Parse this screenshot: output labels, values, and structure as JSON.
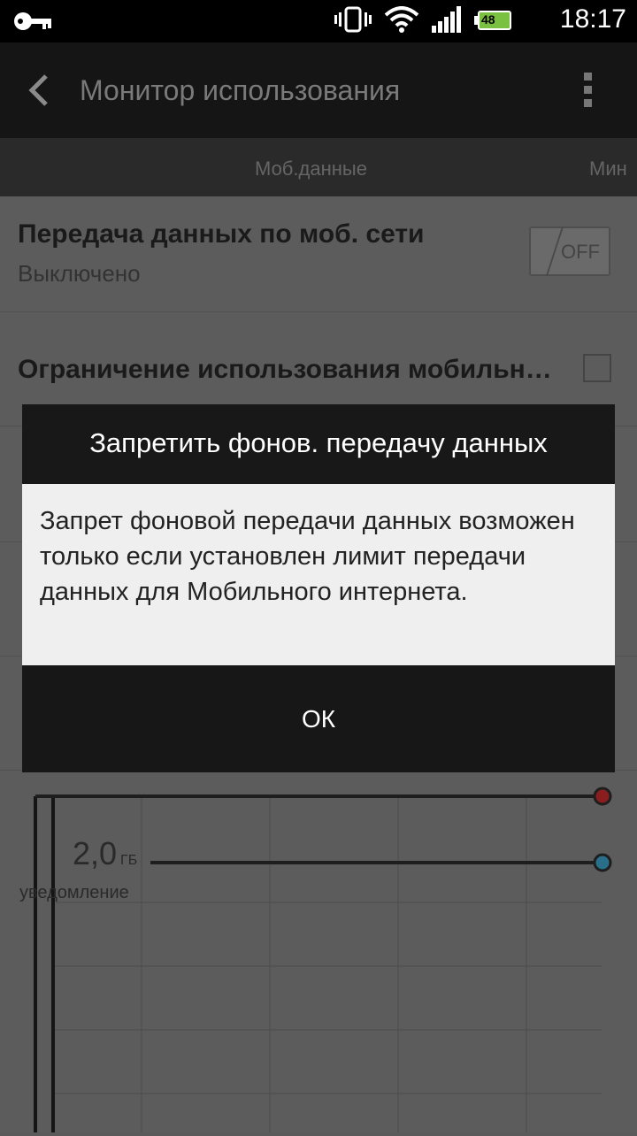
{
  "status_bar": {
    "icons": [
      "key-icon",
      "vibrate-icon",
      "wifi-icon",
      "signal-icon",
      "battery-icon"
    ],
    "battery_level": "48",
    "time": "18:17"
  },
  "action_bar": {
    "title": "Монитор использования"
  },
  "tabs": [
    {
      "label": "Моб.данные"
    },
    {
      "label": "Мин"
    }
  ],
  "settings": {
    "mobile_data": {
      "title": "Передача данных по моб. сети",
      "subtitle": "Выключено",
      "toggle_label": "OFF"
    },
    "limit": {
      "title": "Ограничение использования мобильн…"
    }
  },
  "chart": {
    "threshold_value": "2,0",
    "threshold_unit": "ГБ",
    "threshold_caption": "уведомление",
    "colors": {
      "limit_marker": "#b22222",
      "warning_marker": "#2e7fa0"
    }
  },
  "dialog": {
    "title": "Запретить фонов. передачу данных",
    "message": "Запрет фоновой передачи данных возможен только если установлен лимит передачи данных для Мобильного интернета.",
    "ok_label": "ОК"
  }
}
